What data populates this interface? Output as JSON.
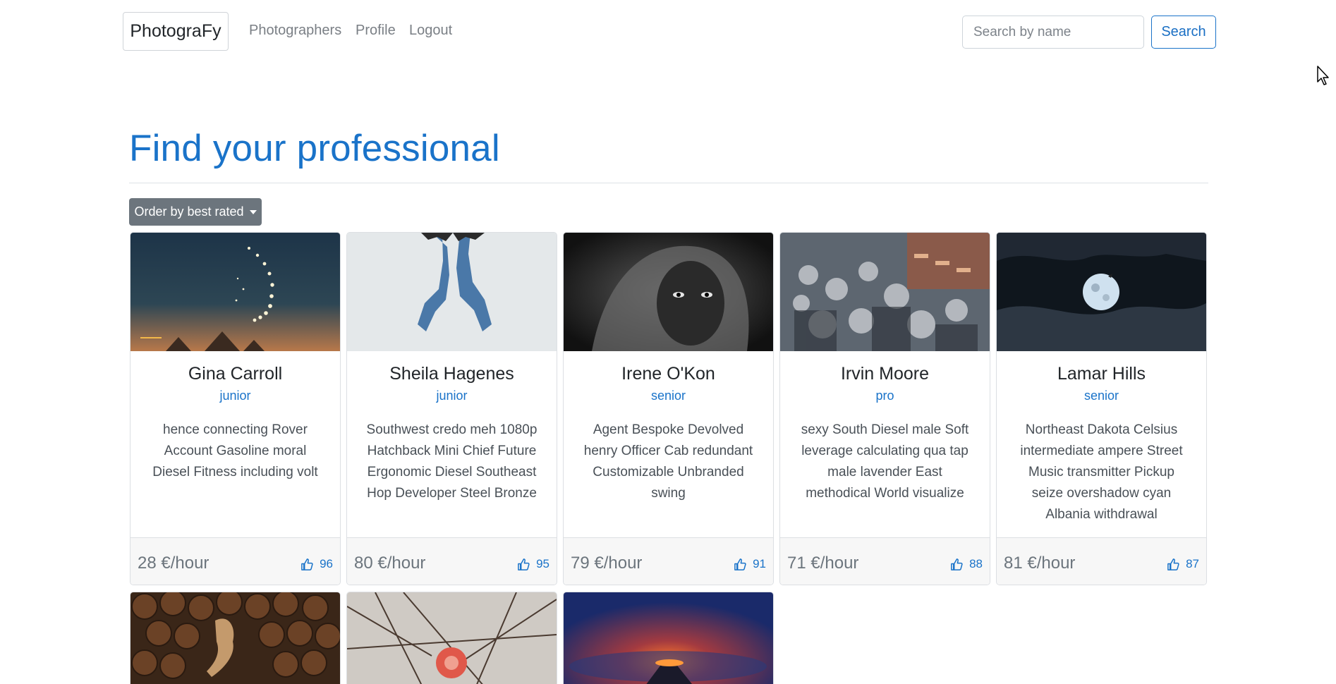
{
  "navbar": {
    "brand": "PhotograFy",
    "links": [
      "Photographers",
      "Profile",
      "Logout"
    ],
    "search_placeholder": "Search by name",
    "search_button": "Search"
  },
  "main": {
    "title": "Find your professional",
    "order_button": "Order by best rated"
  },
  "cards": [
    {
      "name": "Gina Carroll",
      "level": "junior",
      "description": "hence connecting Rover Account Gasoline moral Diesel Fitness including volt",
      "price": "28 €/hour",
      "likes": "96",
      "image": "pyramids-night-sky"
    },
    {
      "name": "Sheila Hagenes",
      "level": "junior",
      "description": "Southwest credo meh 1080p Hatchback Mini Chief Future Ergonomic Diesel Southeast Hop Developer Steel Bronze",
      "price": "80 €/hour",
      "likes": "95",
      "image": "cat-shadows"
    },
    {
      "name": "Irene O'Kon",
      "level": "senior",
      "description": "Agent Bespoke Devolved henry Officer Cab redundant Customizable Unbranded swing",
      "price": "79 €/hour",
      "likes": "91",
      "image": "bw-portrait"
    },
    {
      "name": "Irvin Moore",
      "level": "pro",
      "description": "sexy South Diesel male Soft leverage calculating qua tap male lavender East methodical World visualize",
      "price": "71 €/hour",
      "likes": "88",
      "image": "crowd-motion"
    },
    {
      "name": "Lamar Hills",
      "level": "senior",
      "description": "Northeast Dakota Celsius intermediate ampere Street Music transmitter Pickup seize overshadow cyan Albania withdrawal",
      "price": "81 €/hour",
      "likes": "87",
      "image": "full-moon"
    }
  ],
  "partial_cards": [
    {
      "image": "dog-on-logs"
    },
    {
      "image": "red-bird-branches"
    },
    {
      "image": "volcano-night"
    }
  ]
}
